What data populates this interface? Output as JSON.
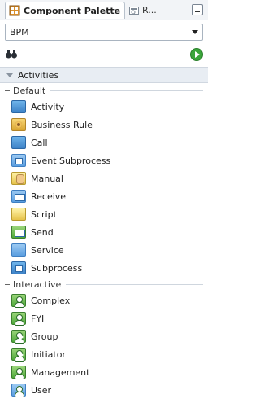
{
  "tabs": {
    "active": "Component Palette",
    "other": "R..."
  },
  "dropdown": {
    "value": "BPM"
  },
  "search": {
    "value": ""
  },
  "section": {
    "title": "Activities"
  },
  "groups": [
    {
      "title": "Default",
      "items": [
        "Activity",
        "Business Rule",
        "Call",
        "Event Subprocess",
        "Manual",
        "Receive",
        "Script",
        "Send",
        "Service",
        "Subprocess"
      ]
    },
    {
      "title": "Interactive",
      "items": [
        "Complex",
        "FYI",
        "Group",
        "Initiator",
        "Management",
        "User"
      ]
    }
  ],
  "icons": {
    "tab_active": "palette-icon",
    "tab_other": "reference-icon",
    "search": "binoculars-icon",
    "go": "go-arrow-icon",
    "minimize": "minimize-icon",
    "caret": "chevron-down-icon"
  }
}
